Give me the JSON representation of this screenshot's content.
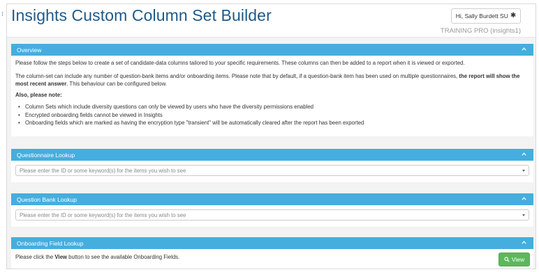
{
  "header": {
    "title": "Insights Custom Column Set Builder",
    "user_button": "Hi, Sally Burdett SU",
    "tenant": "TRAINING PRO (insights1)"
  },
  "overview": {
    "heading": "Overview",
    "para1": "Please follow the steps below to create a set of candidate-data columns tailored to your specific requirements. These columns can then be added to a report when it is viewed or exported.",
    "para2_start": "The column-set can include any number of question-bank items and/or onboarding items. Please note that by default, if a question-bank item has been used on multiple questionnaires, ",
    "para2_bold": "the report will show the most recent answer",
    "para2_end": ". This behaviour can be configured below.",
    "also_note": "Also, please note:",
    "notes": [
      "Column Sets which include diversity questions can only be viewed by users who have the diversity permissions enabled",
      "Encrypted onboarding fields cannot be viewed in Insights",
      "Onboarding fields which are marked as having the encryption type \"transient\" will be automatically cleared after the report has been exported"
    ]
  },
  "questionnaire_lookup": {
    "heading": "Questionnaire Lookup",
    "placeholder": "Please enter the ID or some keyword(s) for the items you wish to see"
  },
  "question_bank_lookup": {
    "heading": "Question Bank Lookup",
    "placeholder": "Please enter the ID or some keyword(s) for the items you wish to see"
  },
  "onboarding_lookup": {
    "heading": "Onboarding Field Lookup",
    "text_start": "Please click the ",
    "text_bold": "View",
    "text_end": " button to see the available Onboarding Fields.",
    "view_button": "View"
  },
  "colors": {
    "panel_header": "#45aedf",
    "title": "#1f5a8a",
    "view_button": "#5cb85c"
  }
}
